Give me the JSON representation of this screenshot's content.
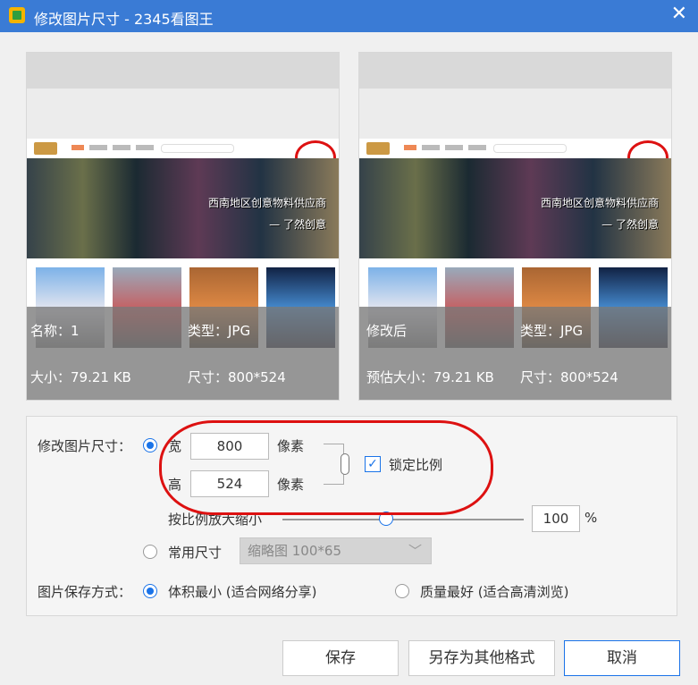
{
  "window": {
    "title": "修改图片尺寸 - 2345看图王"
  },
  "preview_left": {
    "name": "名称：1",
    "type": "类型：JPG",
    "size": "大小：79.21 KB",
    "dims": "尺寸：800*524",
    "banner_line1": "西南地区创意物料供应商",
    "banner_line2": "— 了然创意"
  },
  "preview_right": {
    "name": "修改后",
    "type": "类型：JPG",
    "size": "预估大小：79.21 KB",
    "dims": "尺寸：800*524",
    "banner_line1": "西南地区创意物料供应商",
    "banner_line2": "— 了然创意"
  },
  "resize": {
    "label": "修改图片尺寸：",
    "width_label": "宽",
    "width_value": "800",
    "height_label": "高",
    "height_value": "524",
    "unit": "像素",
    "lock_label": "锁定比例",
    "lock_checked": true,
    "scale_label": "按比例放大缩小",
    "scale_value": "100",
    "scale_unit": "%",
    "scale_fraction": 0.43,
    "common_size_label": "常用尺寸",
    "common_size_selected": "缩略图 100*65"
  },
  "save_mode": {
    "label": "图片保存方式：",
    "option1": "体积最小 (适合网络分享)",
    "option2": "质量最好 (适合高清浏览)"
  },
  "buttons": {
    "save": "保存",
    "save_as": "另存为其他格式",
    "cancel": "取消"
  },
  "colors": {
    "titlebar": "#3a7bd5",
    "accent": "#1a73e8",
    "annotation": "#dd1111"
  }
}
